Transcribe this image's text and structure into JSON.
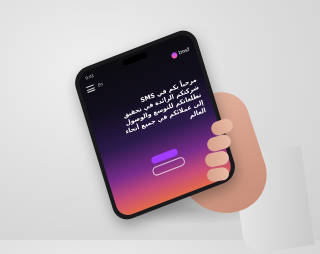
{
  "scene": {
    "background_color": "#dcdcdc",
    "phone_color": "#1a1a1d",
    "screen_gradient_colors": [
      "#0c0c10",
      "#2a1a4a",
      "#7a2c8a",
      "#c34a7a",
      "#e46a4a"
    ],
    "accent_color": "#a23cff"
  },
  "phone_screen": {
    "status_time": "9:41",
    "language_toggle": "En",
    "brand_name": "tmsf",
    "headline_lines": [
      "مرحباً بكم في SMS",
      "شركتكم الرائدة في تحقيق",
      "تطلعاتكم للتوسع والوصول",
      "إلى عملائكم في جميع أنحاء",
      "العالم"
    ],
    "primary_button": "",
    "secondary_button": ""
  }
}
